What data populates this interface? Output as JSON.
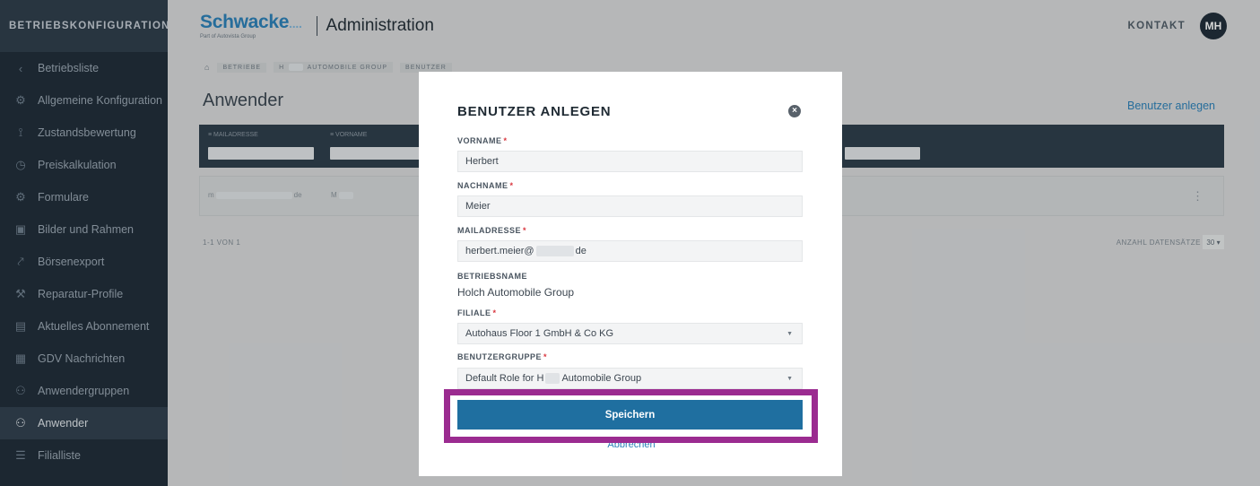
{
  "sidebar": {
    "header": "BETRIEBSKONFIGURATION",
    "items": [
      {
        "label": "Betriebsliste",
        "icon": "back-chevron-icon",
        "glyph": "‹"
      },
      {
        "label": "Allgemeine Konfiguration",
        "icon": "settings-icon",
        "glyph": "⚙"
      },
      {
        "label": "Zustandsbewertung",
        "icon": "condition-icon",
        "glyph": "⟟"
      },
      {
        "label": "Preiskalkulation",
        "icon": "clock-icon",
        "glyph": "◷"
      },
      {
        "label": "Formulare",
        "icon": "form-icon",
        "glyph": "⚙"
      },
      {
        "label": "Bilder und Rahmen",
        "icon": "image-icon",
        "glyph": "▣"
      },
      {
        "label": "Börsenexport",
        "icon": "export-icon",
        "glyph": "⤤"
      },
      {
        "label": "Reparatur-Profile",
        "icon": "wrench-icon",
        "glyph": "⚒"
      },
      {
        "label": "Aktuelles Abonnement",
        "icon": "document-icon",
        "glyph": "▤"
      },
      {
        "label": "GDV Nachrichten",
        "icon": "message-icon",
        "glyph": "▦"
      },
      {
        "label": "Anwendergruppen",
        "icon": "group-icon",
        "glyph": "⚇"
      },
      {
        "label": "Anwender",
        "icon": "users-icon",
        "glyph": "⚇"
      },
      {
        "label": "Filialliste",
        "icon": "list-icon",
        "glyph": "☰"
      }
    ]
  },
  "topbar": {
    "logo_word": "Schwacke",
    "logo_dots": "....",
    "logo_sub": "Part of Autovista Group",
    "title": "Administration",
    "contact": "KONTAKT",
    "avatar": "MH"
  },
  "breadcrumb": [
    "BETRIEBE",
    "H",
    "AUTOMOBILE GROUP",
    "BENUTZER"
  ],
  "page": {
    "title": "Anwender",
    "create_link": "Benutzer anlegen",
    "columns": [
      "≡ MAILADRESSE",
      "≡ VORNAME"
    ],
    "row": {
      "mail_start": "m",
      "mail_end": "de",
      "firstname": "M"
    },
    "pagination": "1-1 VON 1",
    "rows_label": "ANZAHL DATENSÄTZE",
    "rows_value": "30"
  },
  "modal": {
    "title": "BENUTZER ANLEGEN",
    "firstname_label": "VORNAME",
    "firstname_value": "Herbert",
    "lastname_label": "NACHNAME",
    "lastname_value": "Meier",
    "mail_label": "MAILADRESSE",
    "mail_value_start": "herbert.meier@",
    "mail_value_end": "de",
    "company_label": "BETRIEBSNAME",
    "company_value": "Holch Automobile Group",
    "branch_label": "FILIALE",
    "branch_value": "Autohaus Floor 1 GmbH & Co KG",
    "group_label": "BENUTZERGRUPPE",
    "group_value_start": "Default Role for H",
    "group_value_end": "Automobile Group",
    "required_mark": "*",
    "save_label": "Speichern",
    "cancel_label": "Abbrechen"
  },
  "colors": {
    "sidebar_bg": "#1e2a36",
    "accent": "#1f6fa0",
    "link": "#2a7fb8",
    "highlight": "#9b2b90",
    "required": "#d9363e"
  }
}
